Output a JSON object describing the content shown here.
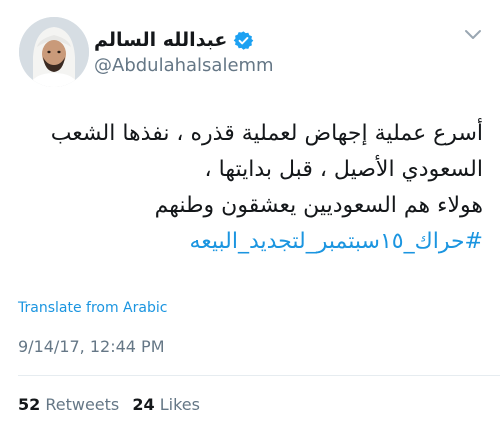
{
  "author": {
    "display_name": "عبدالله السالم",
    "handle": "@Abdulahalsalemm",
    "verified": true
  },
  "tweet": {
    "lines": [
      "أسرع عملية إجهاض لعملية قذره ، نفذها الشعب",
      "السعودي الأصيل ، قبل بدايتها ،",
      "هولاء هم السعوديين يعشقون وطنهم"
    ],
    "hashtag": "#حراك_١٥سبتمبر_لتجديد_البيعه"
  },
  "translate_label": "Translate from Arabic",
  "timestamp": "9/14/17, 12:44 PM",
  "stats": {
    "retweets_count": "52",
    "retweets_label": "Retweets",
    "likes_count": "24",
    "likes_label": "Likes"
  },
  "colors": {
    "link": "#1b95e0",
    "muted": "#657786",
    "text": "#14171a",
    "verified_badge": "#1da1f2"
  },
  "icons": {
    "verified": "verified-badge-icon",
    "more": "chevron-down-icon"
  }
}
